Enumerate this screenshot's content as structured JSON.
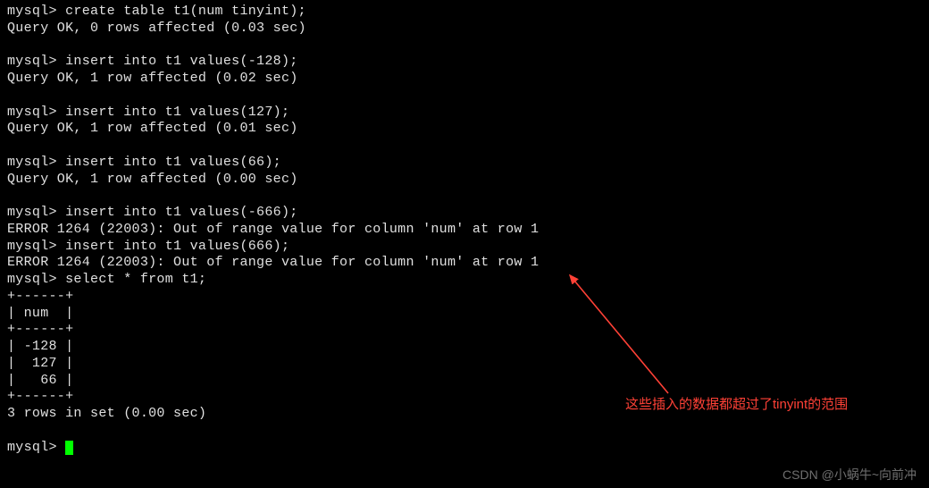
{
  "prompt": "mysql> ",
  "lines": [
    "mysql> create table t1(num tinyint);",
    "Query OK, 0 rows affected (0.03 sec)",
    "",
    "mysql> insert into t1 values(-128);",
    "Query OK, 1 row affected (0.02 sec)",
    "",
    "mysql> insert into t1 values(127);",
    "Query OK, 1 row affected (0.01 sec)",
    "",
    "mysql> insert into t1 values(66);",
    "Query OK, 1 row affected (0.00 sec)",
    "",
    "mysql> insert into t1 values(-666);",
    "ERROR 1264 (22003): Out of range value for column 'num' at row 1",
    "mysql> insert into t1 values(666);",
    "ERROR 1264 (22003): Out of range value for column 'num' at row 1",
    "mysql> select * from t1;",
    "+------+",
    "| num  |",
    "+------+",
    "| -128 |",
    "|  127 |",
    "|   66 |",
    "+------+",
    "3 rows in set (0.00 sec)",
    "",
    "mysql> "
  ],
  "annotation_text": "这些插入的数据都超过了tinyint的范围",
  "watermark_text": "CSDN @小蜗牛~向前冲"
}
